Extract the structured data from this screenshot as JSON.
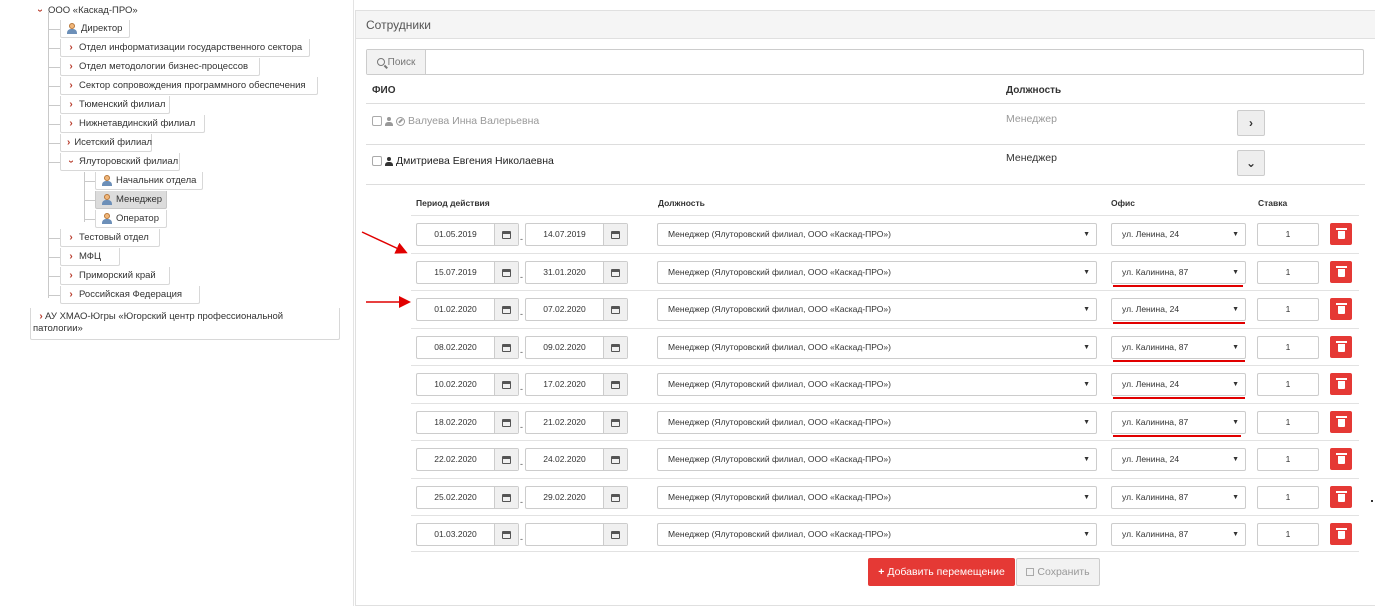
{
  "tree": {
    "root": "ООО «Каскад-ПРО»",
    "items": [
      {
        "label": "Директор",
        "type": "person"
      },
      {
        "label": "Отдел информатизации государственного сектора",
        "type": "dept"
      },
      {
        "label": "Отдел методологии бизнес-процессов",
        "type": "dept"
      },
      {
        "label": "Сектор сопровождения программного обеспечения",
        "type": "dept"
      },
      {
        "label": "Тюменский филиал",
        "type": "dept"
      },
      {
        "label": "Нижнетавдинский филиал",
        "type": "dept"
      },
      {
        "label": "Исетский филиал",
        "type": "dept"
      },
      {
        "label": "Ялуторовский филиал",
        "type": "dept-open"
      },
      {
        "label": "Тестовый отдел",
        "type": "dept"
      },
      {
        "label": "МФЦ",
        "type": "dept"
      },
      {
        "label": "Приморский край",
        "type": "dept"
      },
      {
        "label": "Российская Федерация",
        "type": "dept"
      }
    ],
    "sub_items": [
      {
        "label": "Начальник отдела"
      },
      {
        "label": "Менеджер",
        "selected": true
      },
      {
        "label": "Оператор"
      }
    ],
    "other_root": "АУ ХМАО-Югры «Югорский центр профессиональной патологии»"
  },
  "panel": {
    "title": "Сотрудники",
    "search_label": "Поиск",
    "search_value": "",
    "col_fio": "ФИО",
    "col_position": "Должность",
    "employees": [
      {
        "name": "Валуева Инна Валерьевна",
        "position": "Менеджер",
        "button": "›"
      },
      {
        "name": "Дмитриева Евгения Николаевна",
        "position": "Менеджер",
        "button": "⌄"
      }
    ]
  },
  "moves": {
    "headers": {
      "period": "Период действия",
      "position": "Должность",
      "office": "Офис",
      "rate": "Ставка"
    },
    "rows": [
      {
        "from": "01.05.2019",
        "to": "14.07.2019",
        "position": "Менеджер (Ялуторовский филиал, ООО «Каскад-ПРО»)",
        "office": "ул. Ленина, 24",
        "rate": "1",
        "underlined": false
      },
      {
        "from": "15.07.2019",
        "to": "31.01.2020",
        "position": "Менеджер (Ялуторовский филиал, ООО «Каскад-ПРО»)",
        "office": "ул. Калинина, 87",
        "rate": "1",
        "underlined": true
      },
      {
        "from": "01.02.2020",
        "to": "07.02.2020",
        "position": "Менеджер (Ялуторовский филиал, ООО «Каскад-ПРО»)",
        "office": "ул. Ленина, 24",
        "rate": "1",
        "underlined": true
      },
      {
        "from": "08.02.2020",
        "to": "09.02.2020",
        "position": "Менеджер (Ялуторовский филиал, ООО «Каскад-ПРО»)",
        "office": "ул. Калинина, 87",
        "rate": "1",
        "underlined": true
      },
      {
        "from": "10.02.2020",
        "to": "17.02.2020",
        "position": "Менеджер (Ялуторовский филиал, ООО «Каскад-ПРО»)",
        "office": "ул. Ленина, 24",
        "rate": "1",
        "underlined": true
      },
      {
        "from": "18.02.2020",
        "to": "21.02.2020",
        "position": "Менеджер (Ялуторовский филиал, ООО «Каскад-ПРО»)",
        "office": "ул. Калинина, 87",
        "rate": "1",
        "underlined": true
      },
      {
        "from": "22.02.2020",
        "to": "24.02.2020",
        "position": "Менеджер (Ялуторовский филиал, ООО «Каскад-ПРО»)",
        "office": "ул. Ленина, 24",
        "rate": "1",
        "underlined": false
      },
      {
        "from": "25.02.2020",
        "to": "29.02.2020",
        "position": "Менеджер (Ялуторовский филиал, ООО «Каскад-ПРО»)",
        "office": "ул. Калинина, 87",
        "rate": "1",
        "underlined": false
      },
      {
        "from": "01.03.2020",
        "to": "",
        "position": "Менеджер (Ялуторовский филиал, ООО «Каскад-ПРО»)",
        "office": "ул. Калинина, 87",
        "rate": "1",
        "underlined": false
      }
    ],
    "add_button": "Добавить перемещение",
    "save_button": "Сохранить"
  },
  "colors": {
    "accent": "#e53935",
    "chevron": "#b73a2a",
    "annotation": "#e10000"
  }
}
